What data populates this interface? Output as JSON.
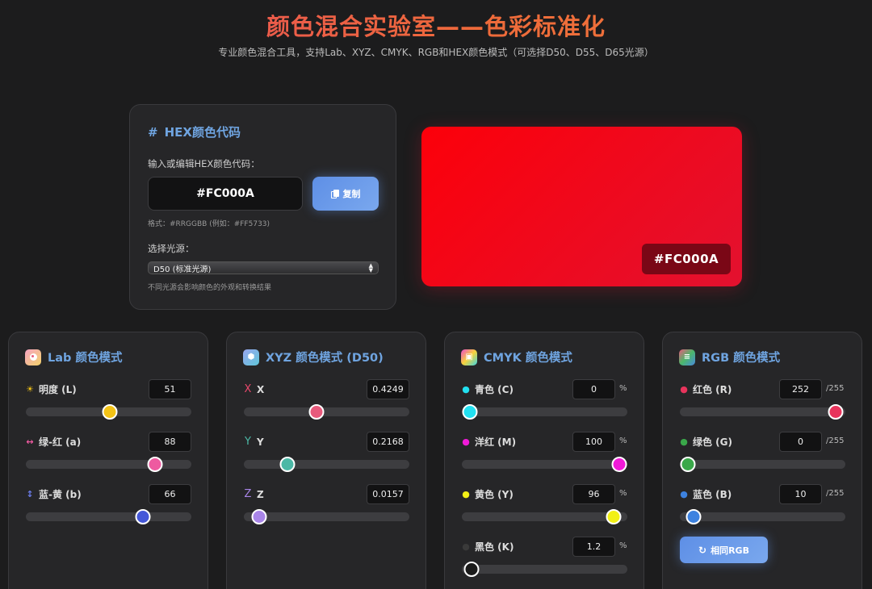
{
  "header": {
    "title": "颜色混合实验室——色彩标准化",
    "subtitle": "专业颜色混合工具，支持Lab、XYZ、CMYK、RGB和HEX颜色模式（可选择D50、D55、D65光源）"
  },
  "hex_panel": {
    "title": "HEX颜色代码",
    "input_label": "输入或编辑HEX颜色代码：",
    "value": "#FC000A",
    "copy_label": "复制",
    "format_hint": "格式：#RRGGBB (例如：#FF5733)",
    "illuminant_label": "选择光源：",
    "illuminant_selected": "D50 (标准光源)",
    "illuminant_note": "不同光源会影响颜色的外观和转换结果"
  },
  "preview": {
    "hex": "#FC000A",
    "color": "#FC000A"
  },
  "lab": {
    "title": "Lab 颜色模式",
    "rows": [
      {
        "label": "明度 (L)",
        "value": "51",
        "fraction": 0.51,
        "thumb": "#f3c316"
      },
      {
        "label": "绿-红 (a)",
        "value": "88",
        "fraction": 0.81,
        "thumb": "#ee5aa0"
      },
      {
        "label": "蓝-黄 (b)",
        "value": "66",
        "fraction": 0.73,
        "thumb": "#4457d8"
      }
    ]
  },
  "xyz": {
    "title": "XYZ 颜色模式 (D50)",
    "rows": [
      {
        "label": "X",
        "value": "0.4249",
        "fraction": 0.43,
        "thumb": "#e85a7c"
      },
      {
        "label": "Y",
        "value": "0.2168",
        "fraction": 0.24,
        "thumb": "#4bb8a6"
      },
      {
        "label": "Z",
        "value": "0.0157",
        "fraction": 0.05,
        "thumb": "#a985e8"
      }
    ]
  },
  "cmyk": {
    "title": "CMYK 颜色模式",
    "unit": "%",
    "rows": [
      {
        "label": "青色 (C)",
        "value": "0",
        "fraction": 0.0,
        "thumb": "#22e0f0"
      },
      {
        "label": "洋红 (M)",
        "value": "100",
        "fraction": 1.0,
        "thumb": "#f01ad8"
      },
      {
        "label": "黄色 (Y)",
        "value": "96",
        "fraction": 0.96,
        "thumb": "#f2f016"
      },
      {
        "label": "黑色 (K)",
        "value": "1.2",
        "fraction": 0.012,
        "thumb": "#1b1b1b"
      }
    ]
  },
  "rgb": {
    "title": "RGB 颜色模式",
    "unit": "/255",
    "same_label": "相同RGB",
    "rows": [
      {
        "label": "红色 (R)",
        "value": "252",
        "fraction": 0.988,
        "thumb": "#e8345c"
      },
      {
        "label": "绿色 (G)",
        "value": "0",
        "fraction": 0.0,
        "thumb": "#3aa84a"
      },
      {
        "label": "蓝色 (B)",
        "value": "10",
        "fraction": 0.04,
        "thumb": "#3d82e0"
      }
    ]
  }
}
